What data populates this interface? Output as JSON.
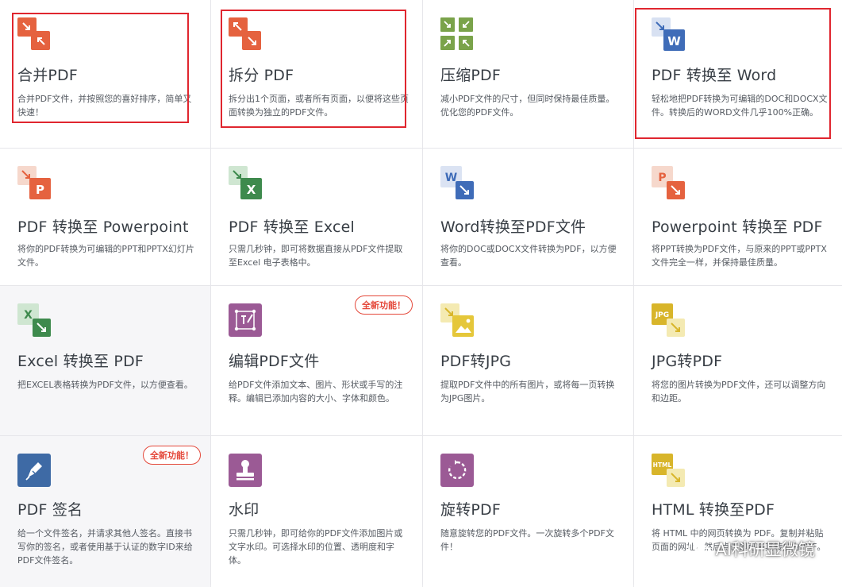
{
  "tools": [
    {
      "title": "合并PDF",
      "desc": "合并PDF文件，并按照您的喜好排序，简单又快速！"
    },
    {
      "title": "拆分 PDF",
      "desc": "拆分出1个页面，或者所有页面，以便将这些页面转换为独立的PDF文件。"
    },
    {
      "title": "压缩PDF",
      "desc": "减小PDF文件的尺寸，但同时保持最佳质量。优化您的PDF文件。"
    },
    {
      "title": "PDF 转换至 Word",
      "desc": "轻松地把PDF转换为可编辑的DOC和DOCX文件。转换后的WORD文件几乎100%正确。"
    },
    {
      "title": "PDF 转换至 Powerpoint",
      "desc": "将你的PDF转换为可编辑的PPT和PPTX幻灯片文件。"
    },
    {
      "title": "PDF 转换至 Excel",
      "desc": "只需几秒钟，即可将数据直接从PDF文件提取至Excel 电子表格中。"
    },
    {
      "title": "Word转换至PDF文件",
      "desc": "将你的DOC或DOCX文件转换为PDF，以方便查看。"
    },
    {
      "title": "Powerpoint 转换至 PDF",
      "desc": "将PPT转换为PDF文件，与原来的PPT或PPTX文件完全一样，并保持最佳质量。"
    },
    {
      "title": "Excel 转换至 PDF",
      "desc": "把EXCEL表格转换为PDF文件，以方便查看。"
    },
    {
      "title": "编辑PDF文件",
      "desc": "给PDF文件添加文本、图片、形状或手写的注释。编辑已添加内容的大小、字体和颜色。",
      "badge": "全新功能！"
    },
    {
      "title": "PDF转JPG",
      "desc": "提取PDF文件中的所有图片，或将每一页转换为JPG图片。"
    },
    {
      "title": "JPG转PDF",
      "desc": "将您的图片转换为PDF文件，还可以调整方向和边距。"
    },
    {
      "title": "PDF 签名",
      "desc": "给一个文件签名，并请求其他人签名。直接书写你的签名，或者使用基于认证的数字ID来给PDF文件签名。",
      "badge": "全新功能！"
    },
    {
      "title": "水印",
      "desc": "只需几秒钟，即可给你的PDF文件添加图片或文字水印。可选择水印的位置、透明度和字体。"
    },
    {
      "title": "旋转PDF",
      "desc": "随意旋转您的PDF文件。一次旋转多个PDF文件！"
    },
    {
      "title": "HTML 转换至PDF",
      "desc": "将 HTML 中的网页转换为 PDF。复制并粘贴页面的网址，然后点击即可将其转换为PDF。"
    }
  ],
  "icons": {
    "word_letter": "W",
    "powerpoint_letter": "P",
    "excel_letter": "X",
    "jpg_label": "JPG",
    "html_label": "HTML"
  },
  "watermark": {
    "text": "AI科研显微镜"
  },
  "colors": {
    "merge": "#e5623f",
    "compress": "#7aa34a",
    "word": "#3f6cb8",
    "excel": "#3e8a4d",
    "edit": "#9b5a95",
    "jpg": "#e5c73a",
    "sign": "#3e6aa5",
    "highlight": "#e0262f",
    "badge": "#e4483a"
  }
}
